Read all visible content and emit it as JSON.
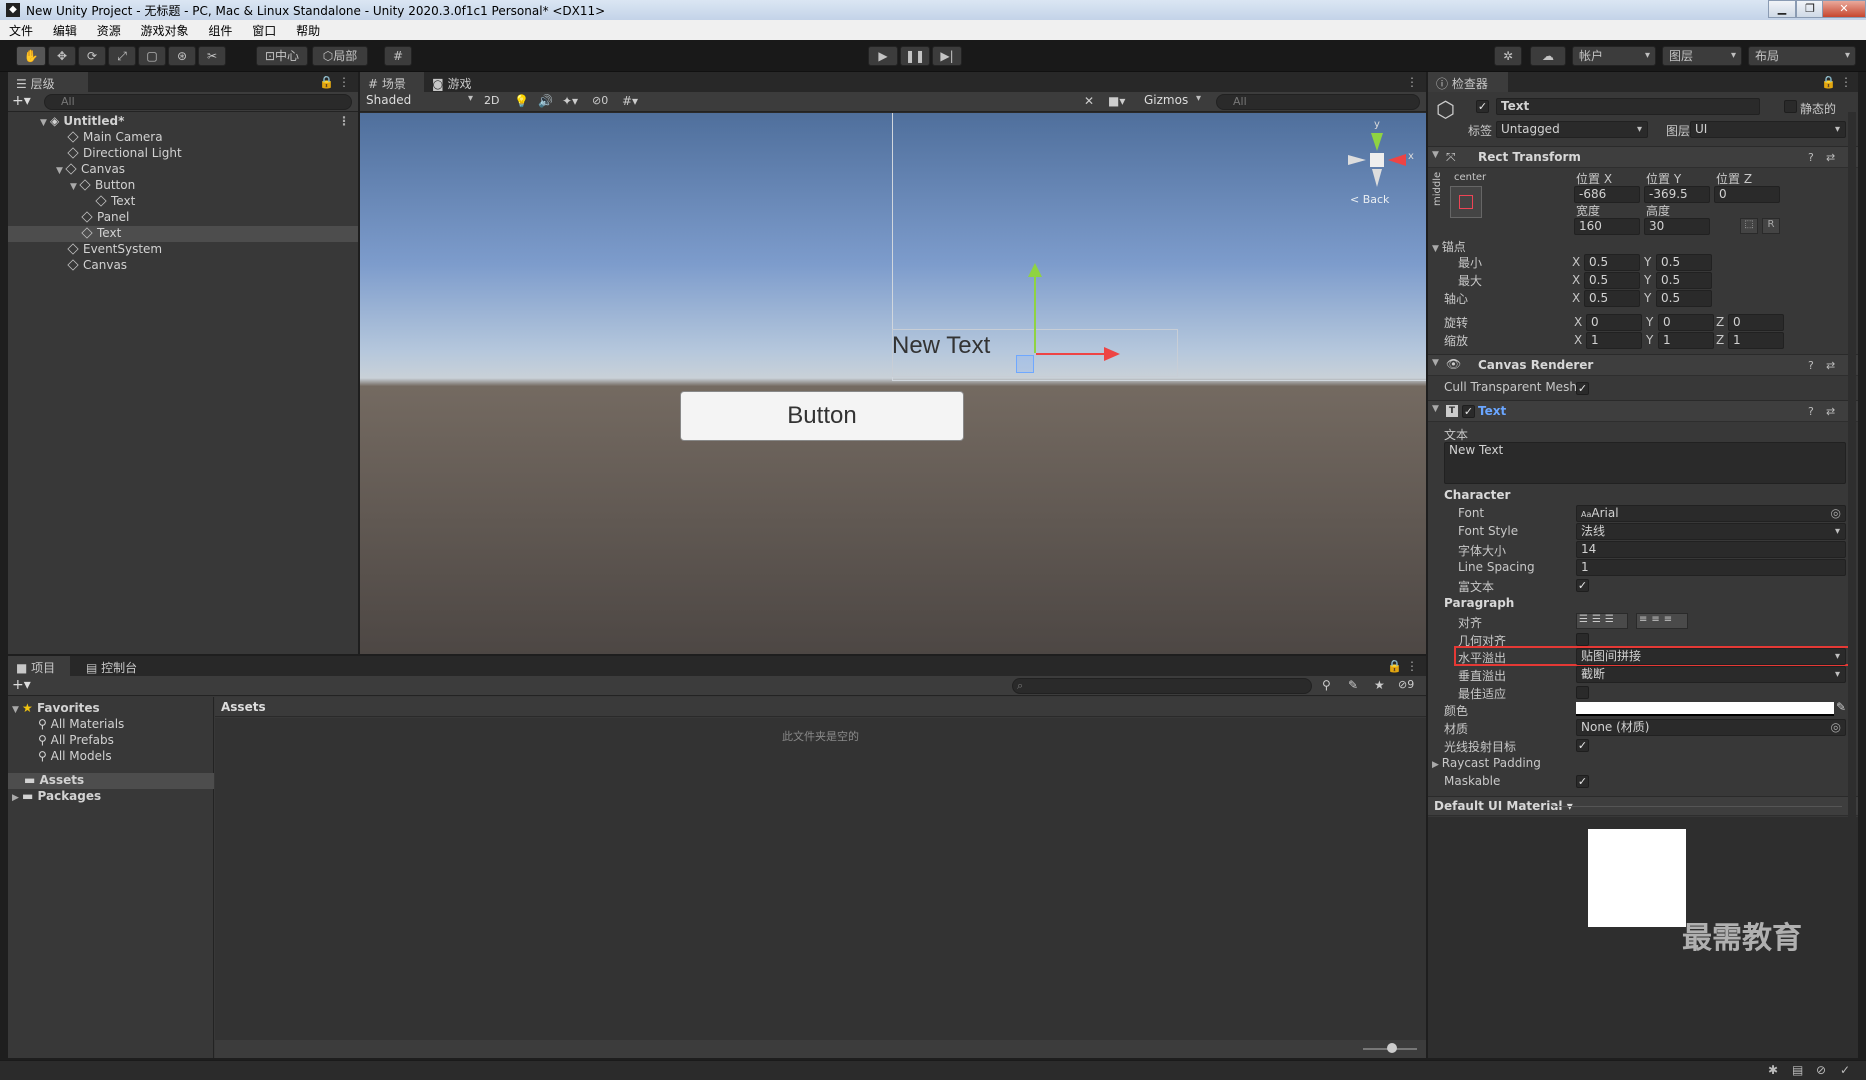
{
  "window": {
    "title": "New Unity Project - 无标题 - PC, Mac & Linux Standalone - Unity 2020.3.0f1c1 Personal* <DX11>"
  },
  "menu": [
    "文件",
    "编辑",
    "资源",
    "游戏对象",
    "组件",
    "窗口",
    "帮助"
  ],
  "toolbar": {
    "center": "中心",
    "local": "局部",
    "account": "帐户",
    "layers": "图层",
    "layout": "布局"
  },
  "hierarchy": {
    "tab": "层级",
    "search_placeholder": "All",
    "items": [
      {
        "label": "Untitled*"
      },
      {
        "label": "Main Camera"
      },
      {
        "label": "Directional Light"
      },
      {
        "label": "Canvas"
      },
      {
        "label": "Button"
      },
      {
        "label": "Text"
      },
      {
        "label": "Panel"
      },
      {
        "label": "Text"
      },
      {
        "label": "EventSystem"
      },
      {
        "label": "Canvas"
      }
    ]
  },
  "scene": {
    "tab_scene": "场景",
    "tab_game": "游戏",
    "shading": "Shaded",
    "mode_2d": "2D",
    "hidden_count": "0",
    "gizmos": "Gizmos",
    "search_placeholder": "All",
    "new_text": "New Text",
    "button_text": "Button",
    "back": "< Back",
    "axis_y": "y",
    "axis_x": "x"
  },
  "project": {
    "tab_project": "项目",
    "tab_console": "控制台",
    "favorites": "Favorites",
    "fav_items": [
      "All Materials",
      "All Prefabs",
      "All Models"
    ],
    "assets": "Assets",
    "packages": "Packages",
    "assets_header": "Assets",
    "empty_msg": "此文件夹是空的",
    "hidden_count": "9"
  },
  "inspector": {
    "tab": "检查器",
    "object_name": "Text",
    "static": "静态的",
    "tag_label": "标签",
    "tag_value": "Untagged",
    "layer_label": "图层",
    "layer_value": "UI",
    "rect": {
      "title": "Rect Transform",
      "anchor_h": "center",
      "anchor_v": "middle",
      "pos_x_label": "位置 X",
      "pos_y_label": "位置 Y",
      "pos_z_label": "位置 Z",
      "pos_x": "-686",
      "pos_y": "-369.5",
      "pos_z": "0",
      "width_label": "宽度",
      "height_label": "高度",
      "width": "160",
      "height": "30",
      "anchors_label": "锚点",
      "min_label": "最小",
      "max_label": "最大",
      "pivot_label": "轴心",
      "rotation_label": "旋转",
      "scale_label": "缩放",
      "min_x": "0.5",
      "min_y": "0.5",
      "max_x": "0.5",
      "max_y": "0.5",
      "pivot_x": "0.5",
      "pivot_y": "0.5",
      "rot_x": "0",
      "rot_y": "0",
      "rot_z": "0",
      "scale_x": "1",
      "scale_y": "1",
      "scale_z": "1",
      "x": "X",
      "y": "Y",
      "z": "Z",
      "r_button": "R"
    },
    "canvas_renderer": {
      "title": "Canvas Renderer",
      "cull_label": "Cull Transparent Mesh"
    },
    "text": {
      "title": "Text",
      "text_label": "文本",
      "text_value": "New Text",
      "character": "Character",
      "font_label": "Font",
      "font_value": "Arial",
      "font_prefix": "Aa",
      "font_style_label": "Font Style",
      "font_style_value": "法线",
      "font_size_label": "字体大小",
      "font_size_value": "14",
      "line_spacing_label": "Line Spacing",
      "line_spacing_value": "1",
      "rich_text_label": "富文本",
      "paragraph": "Paragraph",
      "align_label": "对齐",
      "geo_align_label": "几何对齐",
      "h_overflow_label": "水平溢出",
      "h_overflow_value": "贴图间拼接",
      "v_overflow_label": "垂直溢出",
      "v_overflow_value": "截断",
      "best_fit_label": "最佳适应",
      "color_label": "颜色",
      "material_label": "材质",
      "material_value": "None (材质)",
      "raycast_label": "光线投射目标",
      "raycast_padding_label": "Raycast Padding",
      "maskable_label": "Maskable"
    },
    "material": {
      "title": "Default UI Material"
    }
  },
  "watermark": "最需教育",
  "colors": {
    "highlight": "#e53935",
    "link": "#6aa6ff",
    "dark_bg": "#383838"
  }
}
